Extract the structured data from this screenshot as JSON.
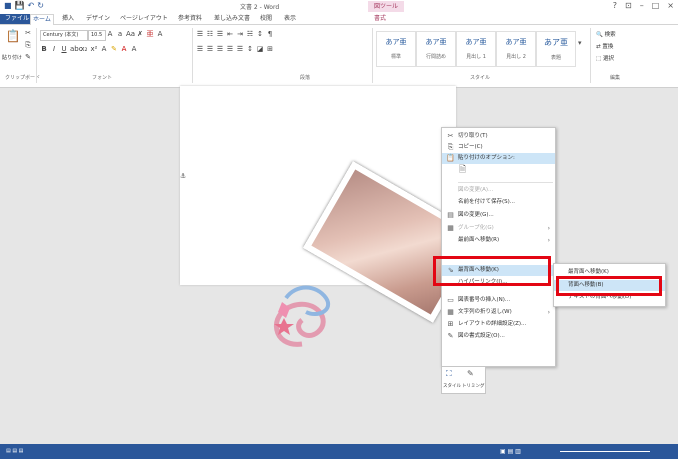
{
  "window": {
    "title": "文書 2 - Word",
    "context_tab": "図ツール",
    "controls": [
      "?",
      "⊡",
      "–",
      "□",
      "×"
    ]
  },
  "tabs": [
    "ファイル",
    "ホーム",
    "挿入",
    "デザイン",
    "ページレイアウト",
    "参考資料",
    "差し込み文書",
    "校閲",
    "表示",
    "書式"
  ],
  "ribbon": {
    "font_name": "Century (本文)",
    "font_size": "10.5",
    "paste_label": "貼り付け",
    "groups": [
      "クリップボード",
      "フォント",
      "段落",
      "スタイル",
      "編集"
    ],
    "styles": [
      {
        "sample": "あア亜",
        "name": "標準"
      },
      {
        "sample": "あア亜",
        "name": "行間詰め"
      },
      {
        "sample": "あア亜",
        "name": "見出し 1"
      },
      {
        "sample": "あア亜",
        "name": "見出し 2"
      },
      {
        "sample": "あア亜",
        "name": "表題"
      }
    ],
    "edit": [
      "検索",
      "置換",
      "選択"
    ]
  },
  "context_menu": {
    "items": [
      {
        "icon": "✂",
        "label": "切り取り(T)",
        "disabled": false
      },
      {
        "icon": "⎘",
        "label": "コピー(C)",
        "disabled": false
      },
      {
        "icon": "📋",
        "label": "貼り付けのオプション:",
        "disabled": false
      },
      {
        "icon": "",
        "label": "",
        "disabled": false
      },
      {
        "icon": "",
        "label": "図の変更(A)...",
        "disabled": true
      },
      {
        "icon": "",
        "label": "名前を付けて保存(S)...",
        "disabled": false
      },
      {
        "icon": "▤",
        "label": "図の変更(G)...",
        "disabled": false
      },
      {
        "icon": "▦",
        "label": "グループ化(G)",
        "disabled": true
      },
      {
        "icon": "",
        "label": "最前面へ移動(R)",
        "disabled": false
      },
      {
        "icon": "⇘",
        "label": "最背面へ移動(K)",
        "disabled": false
      },
      {
        "icon": "",
        "label": "ハイパーリンク(I)...",
        "disabled": false
      },
      {
        "icon": "▭",
        "label": "図表番号の挿入(N)...",
        "disabled": false
      },
      {
        "icon": "▦",
        "label": "文字列の折り返し(W)",
        "disabled": false
      },
      {
        "icon": "⊞",
        "label": "レイアウトの詳細設定(Z)...",
        "disabled": false
      },
      {
        "icon": "✎",
        "label": "図の書式設定(O)...",
        "disabled": false
      }
    ],
    "bottom": [
      "スタイル",
      "トリミング"
    ]
  },
  "submenu": {
    "items": [
      "最背面へ移動(K)",
      "背面へ移動(B)",
      "テキストの背面へ移動(D)"
    ]
  },
  "colors": {
    "accent": "#2b579a",
    "highlight": "#e30613"
  }
}
